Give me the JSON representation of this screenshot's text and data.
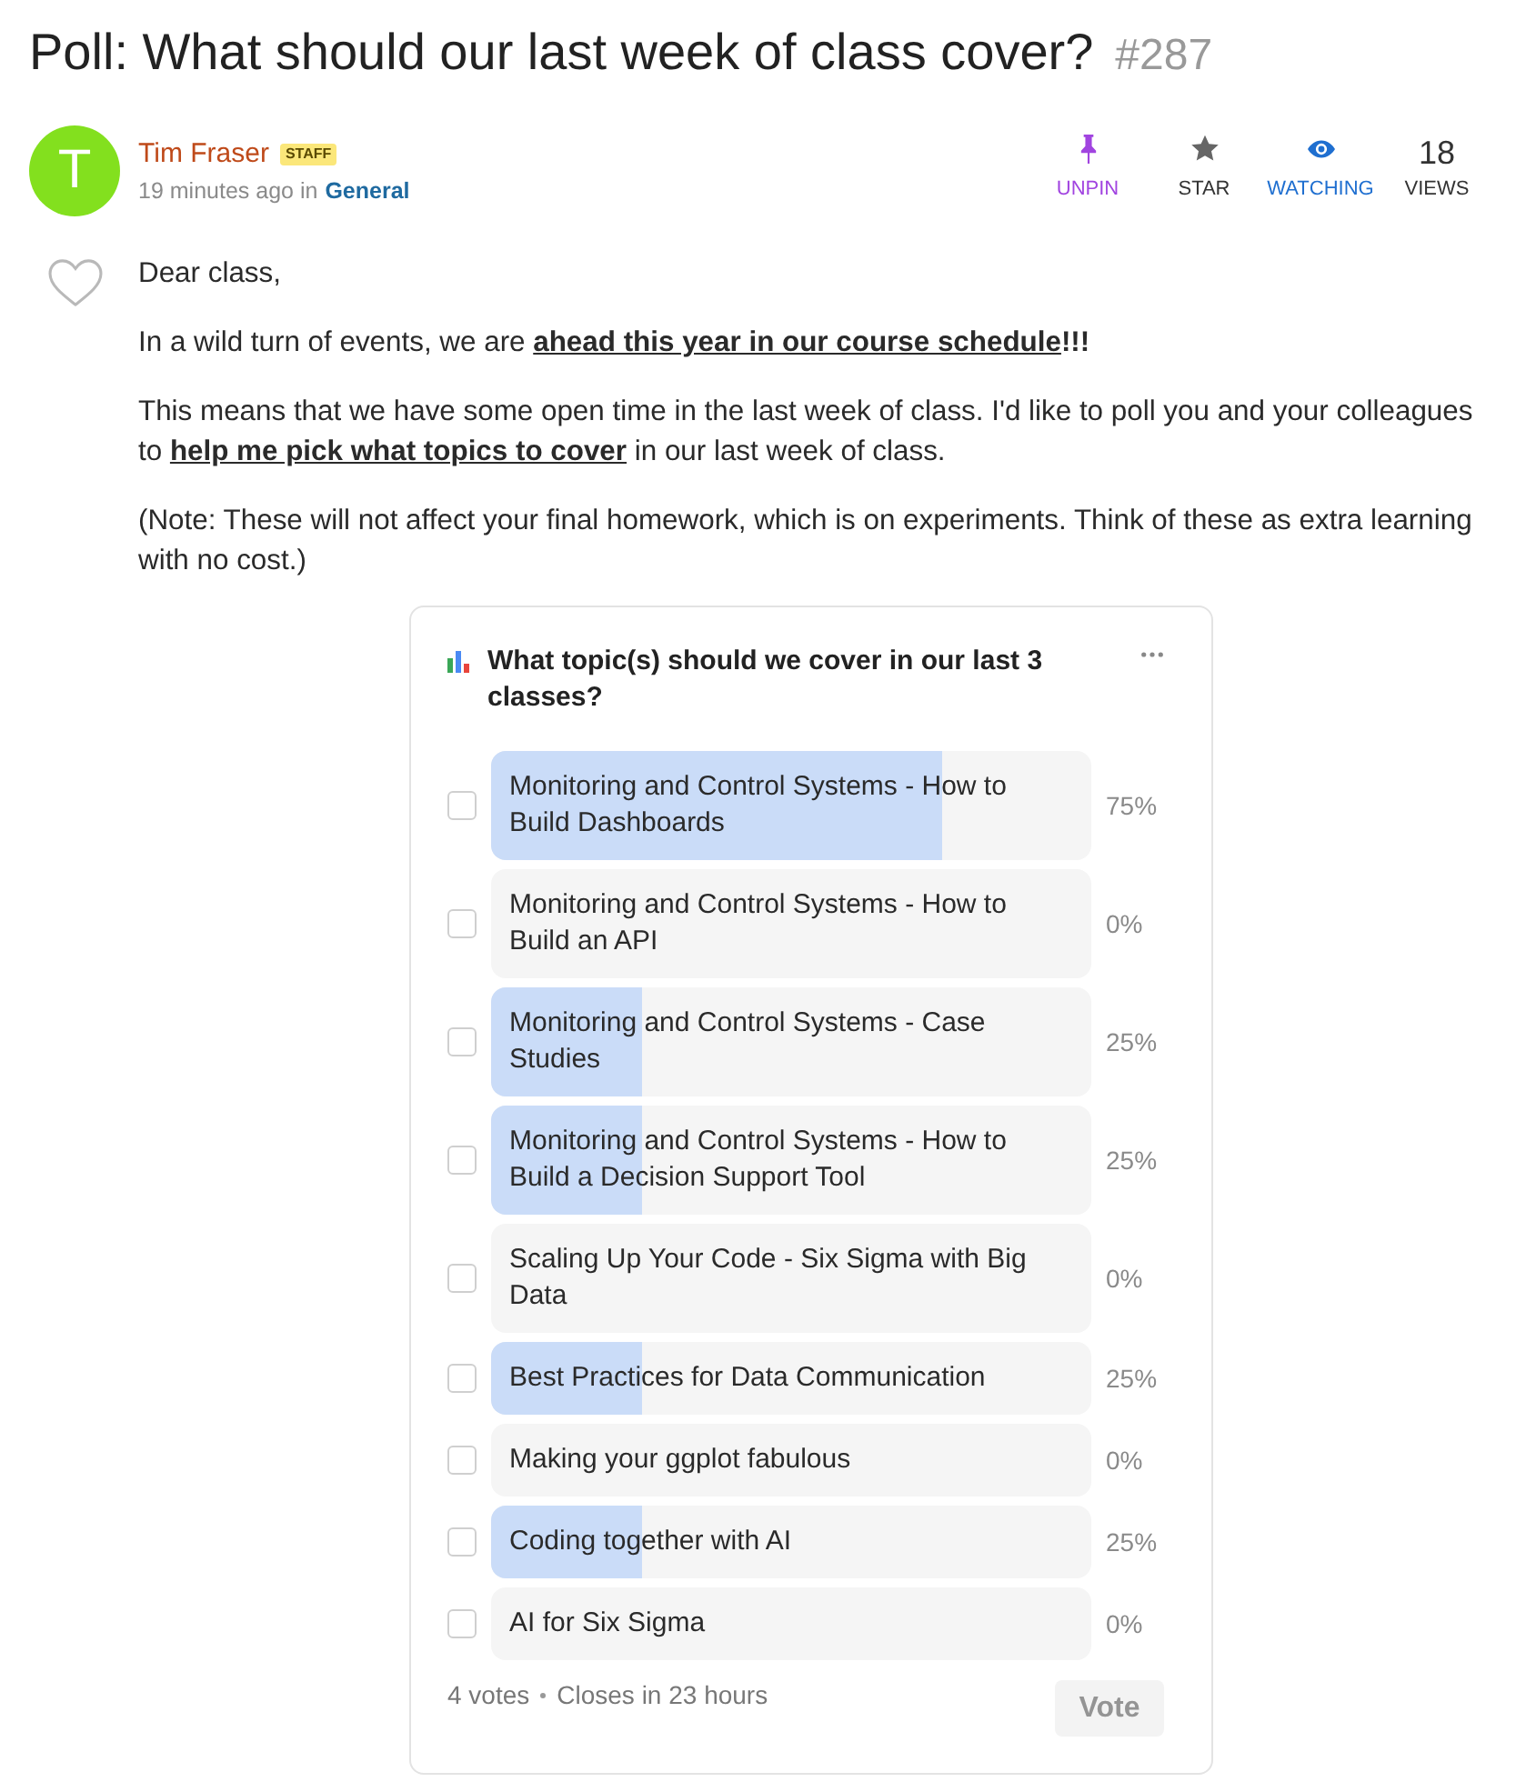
{
  "title": {
    "text": "Poll: What should our last week of class cover?",
    "number": "#287"
  },
  "author": {
    "initial": "T",
    "name": "Tim Fraser",
    "badge": "STAFF",
    "time": "19 minutes ago in",
    "category": "General"
  },
  "actions": [
    {
      "kind": "pin",
      "label": "UNPIN",
      "on": true
    },
    {
      "kind": "star",
      "label": "STAR",
      "on": false
    },
    {
      "kind": "watch",
      "label": "WATCHING",
      "on": true
    },
    {
      "kind": "views",
      "count": "18",
      "label": "VIEWS"
    }
  ],
  "like": {
    "liked": false
  },
  "body": [
    [
      {
        "text": "Dear class,",
        "kind": "plain"
      }
    ],
    [
      {
        "text": "In a wild turn of events, we are ",
        "kind": "plain"
      },
      {
        "text": "ahead this year in our course schedule",
        "kind": "emphasis"
      },
      {
        "text": "!!!",
        "kind": "bold"
      }
    ],
    [
      {
        "text": "This means that we have some open time in the last week of class. I'd like to poll you and your colleagues to ",
        "kind": "plain"
      },
      {
        "text": "help me pick what topics to cover",
        "kind": "emphasis"
      },
      {
        "text": " in our last week of class.",
        "kind": "plain"
      }
    ],
    [
      {
        "text": "(Note: These will not affect your final homework, which is on experiments. Think of these as extra learning with no cost.)",
        "kind": "plain"
      }
    ]
  ],
  "poll": {
    "question": "What topic(s) should we cover in our last 3 classes?",
    "options": [
      {
        "label": "Monitoring and Control Systems - How to Build Dashboards",
        "level": 0.75,
        "percent": "75%",
        "checked": false
      },
      {
        "label": "Monitoring and Control Systems - How to Build an API",
        "level": 0,
        "percent": "0%",
        "checked": false
      },
      {
        "label": "Monitoring and Control Systems - Case Studies",
        "level": 0.25,
        "percent": "25%",
        "checked": false
      },
      {
        "label": "Monitoring and Control Systems - How to Build a Decision Support Tool",
        "level": 0.25,
        "percent": "25%",
        "checked": false
      },
      {
        "label": "Scaling Up Your Code - Six Sigma with Big Data",
        "level": 0,
        "percent": "0%",
        "checked": false
      },
      {
        "label": "Best Practices for Data Communication",
        "level": 0.25,
        "percent": "25%",
        "checked": false
      },
      {
        "label": "Making your ggplot fabulous",
        "level": 0,
        "percent": "0%",
        "checked": false
      },
      {
        "label": "Coding together with AI",
        "level": 0.25,
        "percent": "25%",
        "checked": false
      },
      {
        "label": "AI for Six Sigma",
        "level": 0,
        "percent": "0%",
        "checked": false
      }
    ],
    "votes": "4 votes",
    "closes": "Closes in 23 hours",
    "vote_button": {
      "label": "Vote",
      "disabled": true
    }
  }
}
